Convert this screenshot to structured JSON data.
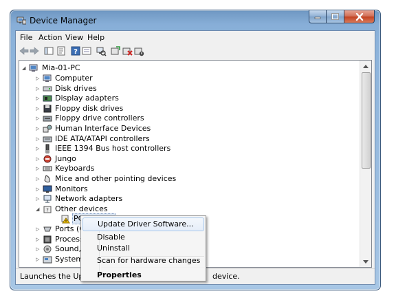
{
  "window": {
    "title": "Device Manager",
    "icons": {
      "app": "device-manager-icon",
      "minimize": "minimize-icon",
      "maximize": "maximize-icon",
      "close": "close-icon"
    }
  },
  "menubar": {
    "items": [
      "File",
      "Action",
      "View",
      "Help"
    ]
  },
  "toolbar": {
    "buttons": [
      "back-arrow-icon",
      "forward-arrow-icon",
      "show-hide-console-tree-icon",
      "properties-icon",
      "help-icon",
      "view-icon",
      "scan-hardware-icon",
      "update-driver-icon",
      "uninstall-icon",
      "disable-device-icon"
    ]
  },
  "tree": {
    "root": "Mia-01-PC",
    "items": [
      {
        "label": "Computer",
        "icon": "computer-icon"
      },
      {
        "label": "Disk drives",
        "icon": "disk-drive-icon"
      },
      {
        "label": "Display adapters",
        "icon": "display-adapter-icon"
      },
      {
        "label": "Floppy disk drives",
        "icon": "floppy-icon"
      },
      {
        "label": "Floppy drive controllers",
        "icon": "floppy-controller-icon"
      },
      {
        "label": "Human Interface Devices",
        "icon": "hid-icon"
      },
      {
        "label": "IDE ATA/ATAPI controllers",
        "icon": "ide-controller-icon"
      },
      {
        "label": "IEEE 1394 Bus host controllers",
        "icon": "ieee1394-icon"
      },
      {
        "label": "Jungo",
        "icon": "jungo-icon"
      },
      {
        "label": "Keyboards",
        "icon": "keyboard-icon"
      },
      {
        "label": "Mice and other pointing devices",
        "icon": "mouse-icon"
      },
      {
        "label": "Monitors",
        "icon": "monitor-icon"
      },
      {
        "label": "Network adapters",
        "icon": "network-adapter-icon"
      },
      {
        "label": "Other devices",
        "icon": "other-devices-icon"
      },
      {
        "label": "PCI Device",
        "icon": "warning-device-icon"
      },
      {
        "label": "Ports (CO",
        "icon": "ports-icon"
      },
      {
        "label": "Processo",
        "icon": "processor-icon"
      },
      {
        "label": "Sound, vi",
        "icon": "sound-icon"
      },
      {
        "label": "System d",
        "icon": "system-devices-icon"
      }
    ]
  },
  "context_menu": {
    "update": "Update Driver Software...",
    "disable": "Disable",
    "uninstall": "Uninstall",
    "scan": "Scan for hardware changes",
    "properties": "Properties"
  },
  "status": {
    "text": "Launches the Update",
    "tail": "device."
  },
  "colors": {
    "window_frame": "#87aed7",
    "close_button": "#c2401f",
    "selection": "#dbe6f4",
    "menu_highlight": "#e6eef9"
  }
}
